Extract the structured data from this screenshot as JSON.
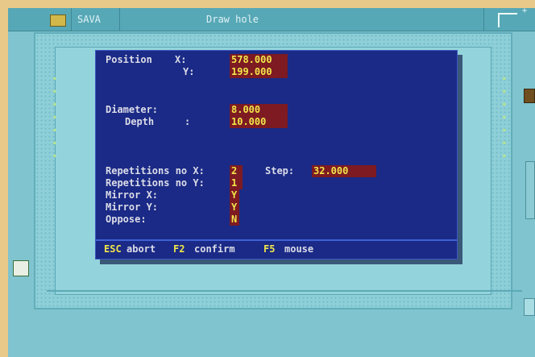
{
  "titlebar": {
    "app_name": "SAVA",
    "window_title": "Draw hole",
    "app_icon": "logo-icon",
    "corner_icon": "resize-corner-icon"
  },
  "dialog": {
    "labels": {
      "position": "Position",
      "x_label": "X:",
      "y_label": "Y:",
      "diameter": "Diameter:",
      "depth": "Depth",
      "depth_colon": ":",
      "rep_x": "Repetitions no X:",
      "rep_y": "Repetitions no Y:",
      "mirror_x": "Mirror X:",
      "mirror_y": "Mirror Y:",
      "oppose": "Oppose:",
      "step": "Step:"
    },
    "values": {
      "pos_x": "578.000",
      "pos_y": "199.000",
      "diameter": "8.000",
      "depth": "10.000",
      "rep_x": "2",
      "rep_y": "1",
      "step": "32.000",
      "mirror_x": "Y",
      "mirror_y": "Y",
      "oppose": "N"
    },
    "footer": {
      "esc_key": "ESC",
      "esc_text": "abort",
      "f2_key": "F2",
      "f2_text": "confirm",
      "f5_key": "F5",
      "f5_text": "mouse"
    }
  },
  "colors": {
    "dialog_bg": "#1a2a86",
    "value_bg": "#7d1a22",
    "value_text": "#f1e64b",
    "label_text": "#dcdce8",
    "desktop": "#7fc4cf"
  }
}
